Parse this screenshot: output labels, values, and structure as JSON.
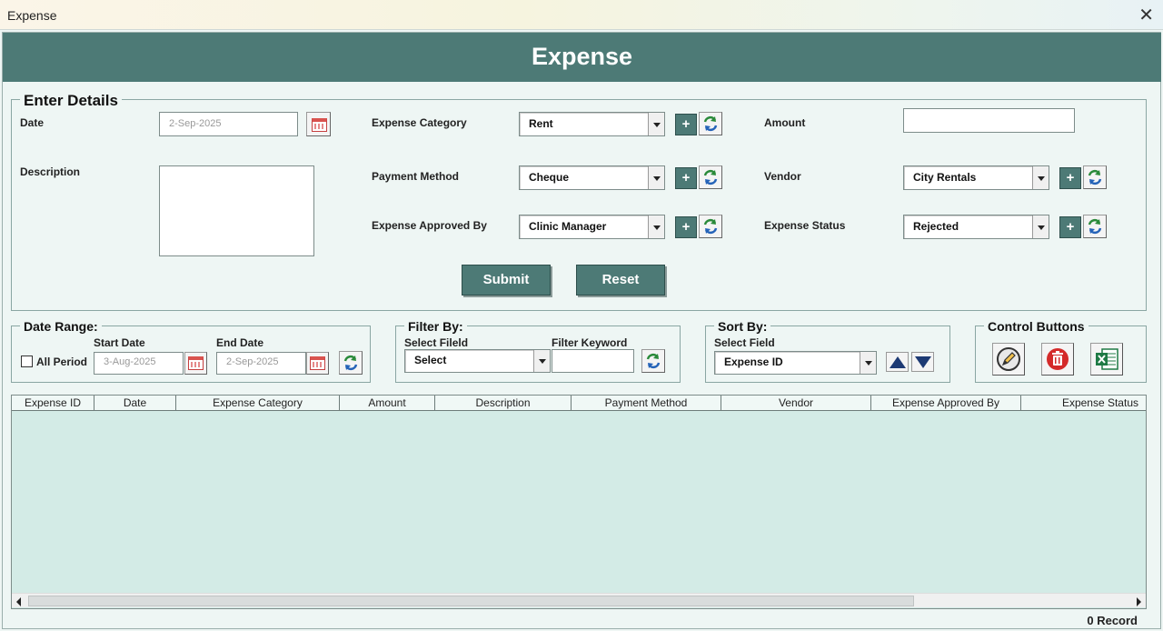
{
  "window": {
    "title": "Expense",
    "close_glyph": "✕"
  },
  "header": {
    "title": "Expense"
  },
  "details": {
    "group_title": "Enter Details",
    "date_label": "Date",
    "date_value": "2-Sep-2025",
    "description_label": "Description",
    "description_value": "",
    "category_label": "Expense Category",
    "category_value": "Rent",
    "payment_label": "Payment Method",
    "payment_value": "Cheque",
    "approved_label": "Expense Approved By",
    "approved_value": "Clinic Manager",
    "amount_label": "Amount",
    "amount_value": "",
    "vendor_label": "Vendor",
    "vendor_value": "City Rentals",
    "status_label": "Expense Status",
    "status_value": "Rejected",
    "plus_glyph": "+",
    "submit_label": "Submit",
    "reset_label": "Reset"
  },
  "date_range": {
    "group_title": "Date Range:",
    "all_period_label": "All Period",
    "start_label": "Start Date",
    "start_value": "3-Aug-2025",
    "end_label": "End Date",
    "end_value": "2-Sep-2025"
  },
  "filter": {
    "group_title": "Filter By:",
    "field_label": "Select Fileld",
    "field_value": "Select",
    "keyword_label": "Filter Keyword",
    "keyword_value": ""
  },
  "sort": {
    "group_title": "Sort By:",
    "field_label": "Select Field",
    "field_value": "Expense ID"
  },
  "control": {
    "group_title": "Control Buttons"
  },
  "grid": {
    "columns": [
      "Expense ID",
      "Date",
      "Expense Category",
      "Amount",
      "Description",
      "Payment Method",
      "Vendor",
      "Expense Approved By",
      "Expense Status"
    ]
  },
  "footer": {
    "record_count": "0 Record"
  },
  "colors": {
    "accent": "#4d7a76",
    "background": "#eef6f4",
    "grid_bg": "#d3ebe6"
  }
}
